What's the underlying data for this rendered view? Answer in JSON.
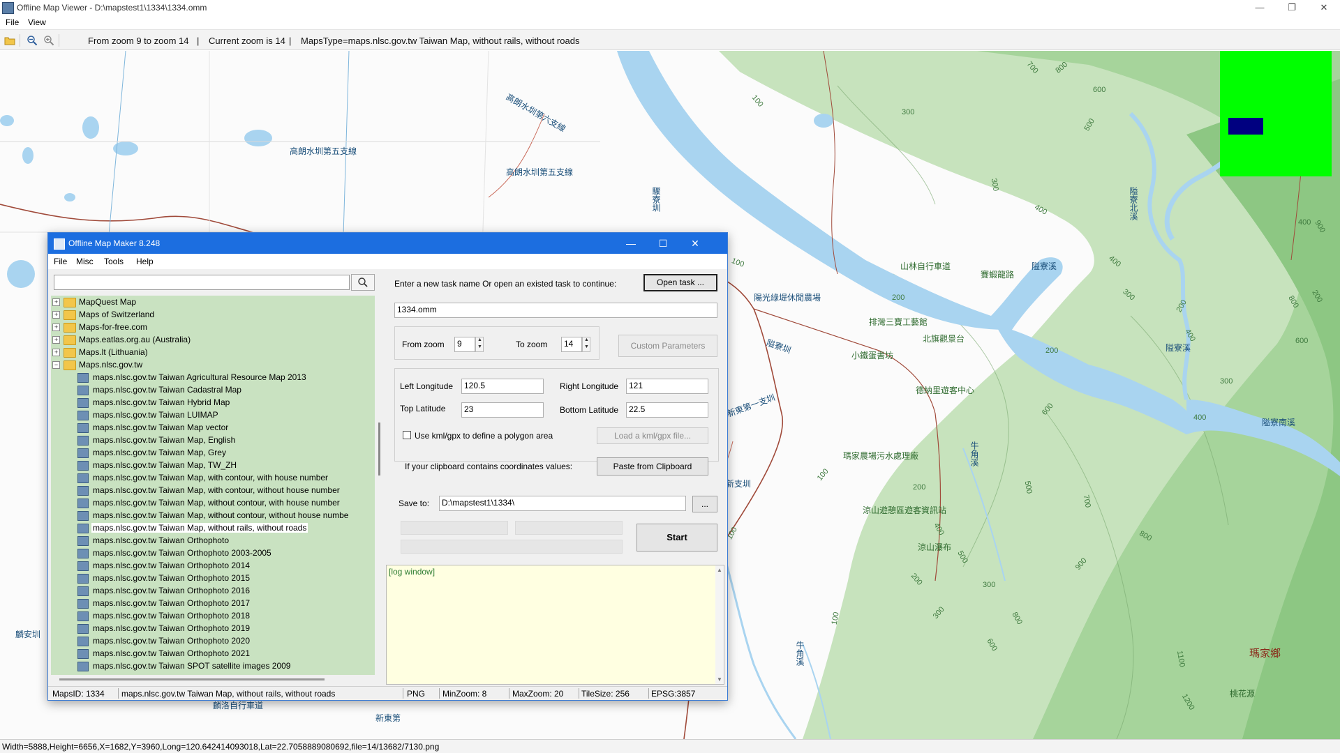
{
  "viewer": {
    "title": "Offline Map Viewer - D:\\mapstest1\\1334\\1334.omm",
    "menu": [
      "File",
      "View"
    ],
    "toolbar": {
      "zoom_range": "From zoom 9 to zoom 14",
      "sep1": "|",
      "current_zoom": "Current zoom is 14",
      "sep2": "|",
      "maps_type": "MapsType=maps.nlsc.gov.tw Taiwan Map, without rails, without roads"
    },
    "status": "Width=5888,Height=6656,X=1682,Y=3960,Long=120.642414093018,Lat=22.7058889080692,file=14/13682/7130.png",
    "map_labels": [
      "高朗水圳第五支線",
      "高朗水圳第六支線",
      "高朗水圳第五支線",
      "驟寮圳",
      "陽光綠堤休閒農場",
      "山林自行車道",
      "賽蝦龍路",
      "隘寮溪",
      "排灣三寶工藝館",
      "北旗觀景台",
      "隘寮圳",
      "小鐵蛋書坊",
      "隘寮北溪",
      "隘寮溪",
      "隘寮南溪",
      "德納里遊客中心",
      "瑪家農場污水處理廠",
      "牛角溪",
      "涼山遊憩區遊客資訊站",
      "涼山瀑布",
      "牛角溪",
      "瑪家鄉",
      "桃花源",
      "麟安圳",
      "新東第",
      "新東第一支圳",
      "新支圳",
      "麟洛自行車道",
      "新東第"
    ],
    "contours": [
      "700",
      "800",
      "600",
      "300",
      "500",
      "100",
      "300",
      "400",
      "400",
      "300",
      "200",
      "800",
      "200",
      "100",
      "400",
      "900",
      "300",
      "600",
      "200",
      "400",
      "600",
      "100",
      "500",
      "700",
      "800",
      "400",
      "500",
      "900",
      "100",
      "200",
      "300",
      "800",
      "600",
      "1100",
      "1200",
      "100",
      "200",
      "300",
      "400",
      "200"
    ],
    "colors": {
      "river": "#a9d4f0",
      "green": "#9ccf94",
      "minimap_bg": "#00ff00",
      "minimap_rect": "#000080",
      "dialog_title": "#1c6ee0",
      "tree_bg": "#c9e2c1"
    }
  },
  "dialog": {
    "title": "Offline Map Maker 8.248",
    "menu": [
      "File",
      "Misc",
      "Tools",
      "Help"
    ],
    "search": {
      "value": ""
    },
    "tree": [
      {
        "label": "MapQuest Map",
        "type": "folder",
        "expanded": false
      },
      {
        "label": "Maps of Switzerland",
        "type": "folder",
        "expanded": false
      },
      {
        "label": "Maps-for-free.com",
        "type": "folder",
        "expanded": false
      },
      {
        "label": "Maps.eatlas.org.au (Australia)",
        "type": "folder",
        "expanded": false
      },
      {
        "label": "Maps.lt (Lithuania)",
        "type": "folder",
        "expanded": false
      },
      {
        "label": "Maps.nlsc.gov.tw",
        "type": "folder",
        "expanded": true
      },
      {
        "label": "maps.nlsc.gov.tw Taiwan Agricultural Resource Map 2013",
        "type": "map"
      },
      {
        "label": "maps.nlsc.gov.tw Taiwan Cadastral Map",
        "type": "map"
      },
      {
        "label": "maps.nlsc.gov.tw Taiwan Hybrid Map",
        "type": "map"
      },
      {
        "label": "maps.nlsc.gov.tw Taiwan LUIMAP",
        "type": "map"
      },
      {
        "label": "maps.nlsc.gov.tw Taiwan Map vector",
        "type": "map"
      },
      {
        "label": "maps.nlsc.gov.tw Taiwan Map, English",
        "type": "map"
      },
      {
        "label": "maps.nlsc.gov.tw Taiwan Map, Grey",
        "type": "map"
      },
      {
        "label": "maps.nlsc.gov.tw Taiwan Map, TW_ZH",
        "type": "map"
      },
      {
        "label": "maps.nlsc.gov.tw Taiwan Map, with contour, with house number",
        "type": "map"
      },
      {
        "label": "maps.nlsc.gov.tw Taiwan Map, with contour, without house number",
        "type": "map"
      },
      {
        "label": "maps.nlsc.gov.tw Taiwan Map, without contour, with house number",
        "type": "map"
      },
      {
        "label": "maps.nlsc.gov.tw Taiwan Map, without contour, without house numbe",
        "type": "map"
      },
      {
        "label": "maps.nlsc.gov.tw Taiwan Map, without rails, without roads",
        "type": "map",
        "selected": true
      },
      {
        "label": "maps.nlsc.gov.tw Taiwan Orthophoto",
        "type": "map"
      },
      {
        "label": "maps.nlsc.gov.tw Taiwan Orthophoto 2003-2005",
        "type": "map"
      },
      {
        "label": "maps.nlsc.gov.tw Taiwan Orthophoto 2014",
        "type": "map"
      },
      {
        "label": "maps.nlsc.gov.tw Taiwan Orthophoto 2015",
        "type": "map"
      },
      {
        "label": "maps.nlsc.gov.tw Taiwan Orthophoto 2016",
        "type": "map"
      },
      {
        "label": "maps.nlsc.gov.tw Taiwan Orthophoto 2017",
        "type": "map"
      },
      {
        "label": "maps.nlsc.gov.tw Taiwan Orthophoto 2018",
        "type": "map"
      },
      {
        "label": "maps.nlsc.gov.tw Taiwan Orthophoto 2019",
        "type": "map"
      },
      {
        "label": "maps.nlsc.gov.tw Taiwan Orthophoto 2020",
        "type": "map"
      },
      {
        "label": "maps.nlsc.gov.tw Taiwan Orthophoto 2021",
        "type": "map"
      },
      {
        "label": "maps.nlsc.gov.tw Taiwan SPOT satellite images 2009",
        "type": "map"
      }
    ],
    "form": {
      "task_prompt": "Enter a new task name Or open an existed task to continue:",
      "open_task": "Open task ...",
      "task_name": "1334.omm",
      "from_zoom_label": "From zoom",
      "from_zoom": "9",
      "to_zoom_label": "To zoom",
      "to_zoom": "14",
      "custom_params": "Custom Parameters",
      "left_lon_label": "Left Longitude",
      "left_lon": "120.5",
      "right_lon_label": "Right Longitude",
      "right_lon": "121",
      "top_lat_label": "Top Latitude",
      "top_lat": "23",
      "bottom_lat_label": "Bottom Latitude",
      "bottom_lat": "22.5",
      "kml_label": "Use kml/gpx to define a polygon area",
      "load_kml": "Load a kml/gpx file...",
      "clipboard_label": "If your clipboard contains coordinates values:",
      "paste_btn": "Paste from Clipboard",
      "save_to_label": "Save to:",
      "save_to": "D:\\mapstest1\\1334\\",
      "browse": "...",
      "start": "Start",
      "log_title": "[log window]"
    },
    "status": {
      "maps_id": "MapsID: 1334",
      "maps_name": "maps.nlsc.gov.tw Taiwan Map, without rails, without roads",
      "format": "PNG",
      "min_zoom": "MinZoom: 8",
      "max_zoom": "MaxZoom: 20",
      "tile_size": "TileSize: 256",
      "epsg": "EPSG:3857"
    }
  }
}
